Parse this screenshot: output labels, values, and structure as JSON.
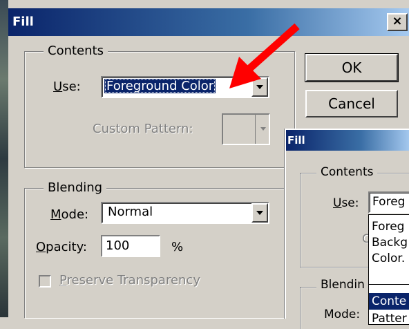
{
  "dialog_front": {
    "title": "Fill",
    "close_glyph": "×",
    "contents_group": "Contents",
    "use_label": {
      "before": "",
      "accent": "U",
      "after": "se:"
    },
    "use_value": "Foreground Color",
    "custom_pattern_label": "Custom Pattern:",
    "blending_group": "Blending",
    "mode_label": {
      "before": "",
      "accent": "M",
      "after": "ode:"
    },
    "mode_value": "Normal",
    "opacity_label": {
      "before": "",
      "accent": "O",
      "after": "pacity:"
    },
    "opacity_value": "100",
    "opacity_unit": "%",
    "preserve_label": {
      "before": "",
      "accent": "P",
      "after": "reserve Transparency"
    },
    "ok_label": "OK",
    "cancel_label": "Cancel"
  },
  "dialog_back": {
    "title": "Fill",
    "contents_group": "Contents",
    "use_label": {
      "before": "",
      "accent": "U",
      "after": "se:"
    },
    "use_value": "Foreg",
    "blending_group": "Blendin",
    "mode_label": "Mode:",
    "dropdown_items": [
      "Foreg",
      "Backg",
      "Color.",
      "Conte",
      "Patter"
    ],
    "behind_list_char": "C"
  },
  "annotation": {
    "icon": "red-arrow-icon",
    "color": "#ff0000"
  },
  "colors": {
    "titlebar_start": "#0a246a",
    "titlebar_end": "#a6caf0",
    "face": "#d4d0c8",
    "highlight": "#0a246a"
  }
}
